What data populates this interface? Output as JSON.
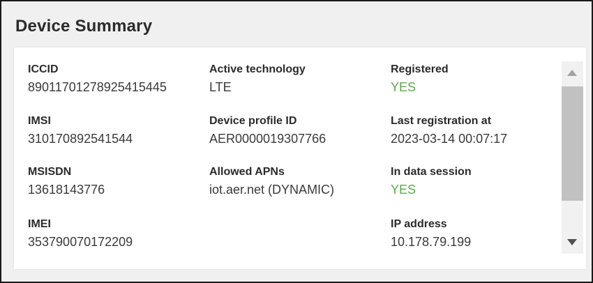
{
  "title": "Device Summary",
  "fields": {
    "iccid": {
      "label": "ICCID",
      "value": "89011701278925415445"
    },
    "active_technology": {
      "label": "Active technology",
      "value": "LTE"
    },
    "registered": {
      "label": "Registered",
      "value": "YES"
    },
    "imsi": {
      "label": "IMSI",
      "value": "310170892541544"
    },
    "device_profile_id": {
      "label": "Device profile ID",
      "value": "AER0000019307766"
    },
    "last_registration_at": {
      "label": "Last registration at",
      "value": "2023-03-14 00:07:17"
    },
    "msisdn": {
      "label": "MSISDN",
      "value": "13618143776"
    },
    "allowed_apns": {
      "label": "Allowed APNs",
      "value": "iot.aer.net (DYNAMIC)"
    },
    "in_data_session": {
      "label": "In data session",
      "value": "YES"
    },
    "imei": {
      "label": "IMEI",
      "value": "353790070172209"
    },
    "ip_address": {
      "label": "IP address",
      "value": "10.178.79.199"
    }
  },
  "colors": {
    "status_yes": "#5aab4a",
    "label_text": "#2b2b2b",
    "value_text": "#3a3a3a"
  },
  "icons": {
    "scroll_up": "arrow-up-icon",
    "scroll_down": "arrow-down-icon"
  }
}
